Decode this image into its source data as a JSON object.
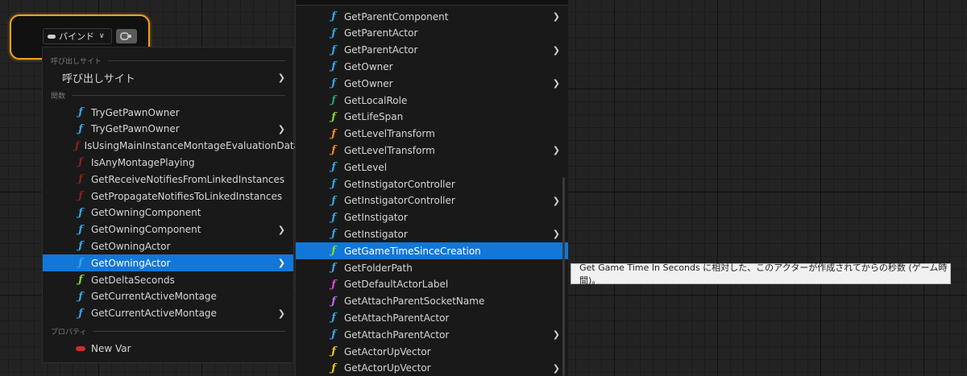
{
  "node": {
    "bind_label": "バインド",
    "bind_chevron": "∨"
  },
  "menu1": {
    "section_callsite": "呼び出しサイト",
    "callsite_item": "呼び出しサイト",
    "section_functions": "関数",
    "section_properties": "プロパティ",
    "functions": [
      {
        "label": "TryGetPawnOwner",
        "color": "#35a6e8",
        "submenu": false
      },
      {
        "label": "TryGetPawnOwner",
        "color": "#35a6e8",
        "submenu": true
      },
      {
        "label": "IsUsingMainInstanceMontageEvaluationData",
        "color": "#8c1f1f",
        "submenu": false
      },
      {
        "label": "IsAnyMontagePlaying",
        "color": "#8c1f1f",
        "submenu": false
      },
      {
        "label": "GetReceiveNotifiesFromLinkedInstances",
        "color": "#8c1f1f",
        "submenu": false
      },
      {
        "label": "GetPropagateNotifiesToLinkedInstances",
        "color": "#8c1f1f",
        "submenu": false
      },
      {
        "label": "GetOwningComponent",
        "color": "#35a6e8",
        "submenu": false
      },
      {
        "label": "GetOwningComponent",
        "color": "#35a6e8",
        "submenu": true
      },
      {
        "label": "GetOwningActor",
        "color": "#35a6e8",
        "submenu": false
      },
      {
        "label": "GetOwningActor",
        "color": "#35a6e8",
        "submenu": true,
        "selected": true
      },
      {
        "label": "GetDeltaSeconds",
        "color": "#7fd83a",
        "submenu": false
      },
      {
        "label": "GetCurrentActiveMontage",
        "color": "#35a6e8",
        "submenu": false
      },
      {
        "label": "GetCurrentActiveMontage",
        "color": "#35a6e8",
        "submenu": true
      }
    ],
    "property": {
      "label": "New Var",
      "color": "#cf2a2a"
    }
  },
  "menu2": {
    "items": [
      {
        "label": "GetParentComponent",
        "color": "#35a6e8",
        "submenu": true
      },
      {
        "label": "GetParentActor",
        "color": "#35a6e8",
        "submenu": false
      },
      {
        "label": "GetParentActor",
        "color": "#35a6e8",
        "submenu": true
      },
      {
        "label": "GetOwner",
        "color": "#35a6e8",
        "submenu": false
      },
      {
        "label": "GetOwner",
        "color": "#35a6e8",
        "submenu": true
      },
      {
        "label": "GetLocalRole",
        "color": "#1f9e86",
        "submenu": false
      },
      {
        "label": "GetLifeSpan",
        "color": "#7fd83a",
        "submenu": false
      },
      {
        "label": "GetLevelTransform",
        "color": "#f08a2a",
        "submenu": false
      },
      {
        "label": "GetLevelTransform",
        "color": "#f08a2a",
        "submenu": true
      },
      {
        "label": "GetLevel",
        "color": "#35a6e8",
        "submenu": false
      },
      {
        "label": "GetInstigatorController",
        "color": "#35a6e8",
        "submenu": false
      },
      {
        "label": "GetInstigatorController",
        "color": "#35a6e8",
        "submenu": true
      },
      {
        "label": "GetInstigator",
        "color": "#35a6e8",
        "submenu": false
      },
      {
        "label": "GetInstigator",
        "color": "#35a6e8",
        "submenu": true
      },
      {
        "label": "GetGameTimeSinceCreation",
        "color": "#7fd83a",
        "submenu": false,
        "selected": true
      },
      {
        "label": "GetFolderPath",
        "color": "#35a6e8",
        "submenu": false
      },
      {
        "label": "GetDefaultActorLabel",
        "color": "#e03ee0",
        "submenu": false
      },
      {
        "label": "GetAttachParentSocketName",
        "color": "#b56cf0",
        "submenu": false
      },
      {
        "label": "GetAttachParentActor",
        "color": "#35a6e8",
        "submenu": false
      },
      {
        "label": "GetAttachParentActor",
        "color": "#35a6e8",
        "submenu": true
      },
      {
        "label": "GetActorUpVector",
        "color": "#f2c21e",
        "submenu": false
      },
      {
        "label": "GetActorUpVector",
        "color": "#f2c21e",
        "submenu": true
      }
    ]
  },
  "tooltip": {
    "text": "Get Game Time In Seconds に相対した、このアクターが作成されてからの秒数 (ゲーム時間)。"
  },
  "icons": {
    "function": "ƒ",
    "submenu_arrow": "❯"
  }
}
